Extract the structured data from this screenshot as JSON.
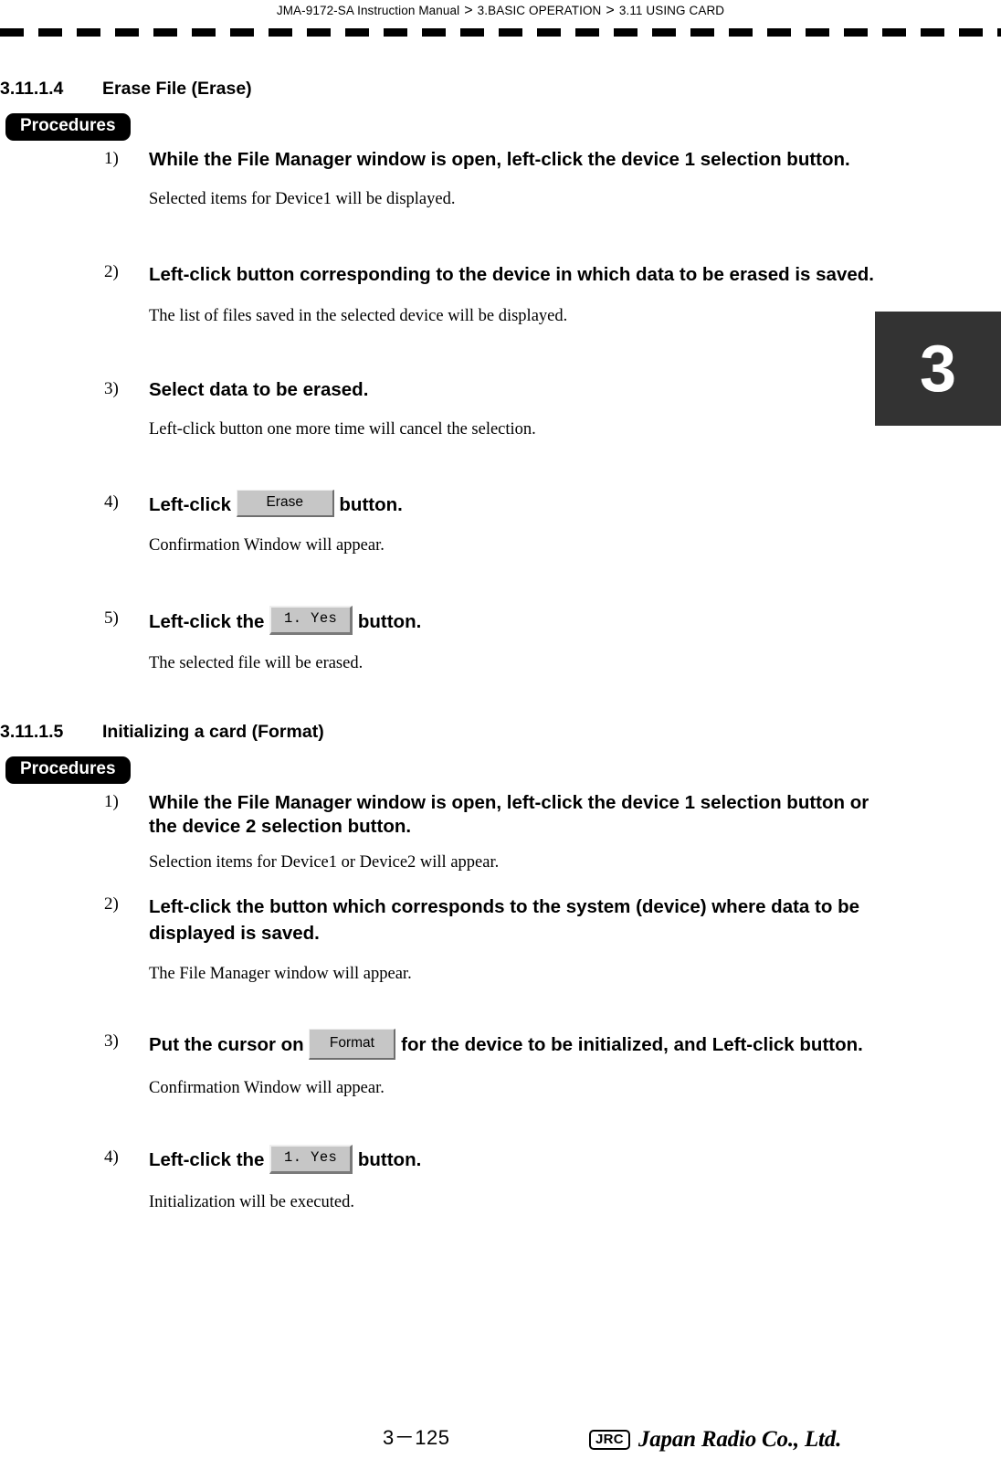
{
  "header": {
    "crumb1": "JMA-9172-SA Instruction Manual",
    "sep": ">",
    "crumb2": "3.BASIC OPERATION",
    "crumb3": "3.11  USING CARD"
  },
  "chapter_tab": {
    "label": "3"
  },
  "sections": [
    {
      "number": "3.11.1.4",
      "title": "Erase File (Erase)",
      "badge": "Procedures",
      "steps": [
        {
          "marker": "1)",
          "title": "While the File Manager window is open, left-click the device 1 selection button.",
          "note": "Selected items for  Device1  will be displayed."
        },
        {
          "marker": "2)",
          "title": "Left-click button corresponding to the device in which data to be erased is saved.",
          "note": "The list of files saved in the selected device will be displayed."
        },
        {
          "marker": "3)",
          "title": "Select data to be erased.",
          "note": "Left-click button one more time will cancel the selection."
        },
        {
          "marker": "4)",
          "title_before": "Left-click",
          "button": "Erase",
          "title_after": "button.",
          "note": "Confirmation Window will appear."
        },
        {
          "marker": "5)",
          "title_before": "Left-click the",
          "button": "1. Yes",
          "title_after": "button.",
          "note": "The selected file will be erased."
        }
      ]
    },
    {
      "number": "3.11.1.5",
      "title": "Initializing a card (Format)",
      "badge": "Procedures",
      "steps": [
        {
          "marker": "1)",
          "title": "While the File Manager window is open, left-click the device 1 selection button or the device 2 selection button.",
          "note": " Selection items for  Device1  or  Device2  will appear."
        },
        {
          "marker": "2)",
          "title": "Left-click the button which corresponds to the system (device) where data to be displayed is saved.",
          "note": "The File Manager window will appear."
        },
        {
          "marker": "3)",
          "title_before": "Put the cursor on",
          "button": "Format",
          "title_after": "for the device to be initialized, and Left-click button.",
          "note": "Confirmation Window will appear."
        },
        {
          "marker": "4)",
          "title_before": "Left-click the",
          "button": "1. Yes",
          "title_after": "button.",
          "note": "Initialization will be executed."
        }
      ]
    }
  ],
  "footer": {
    "page_number": "3－125",
    "logo_mark": "JRC",
    "company": "Japan Radio Co., Ltd."
  }
}
